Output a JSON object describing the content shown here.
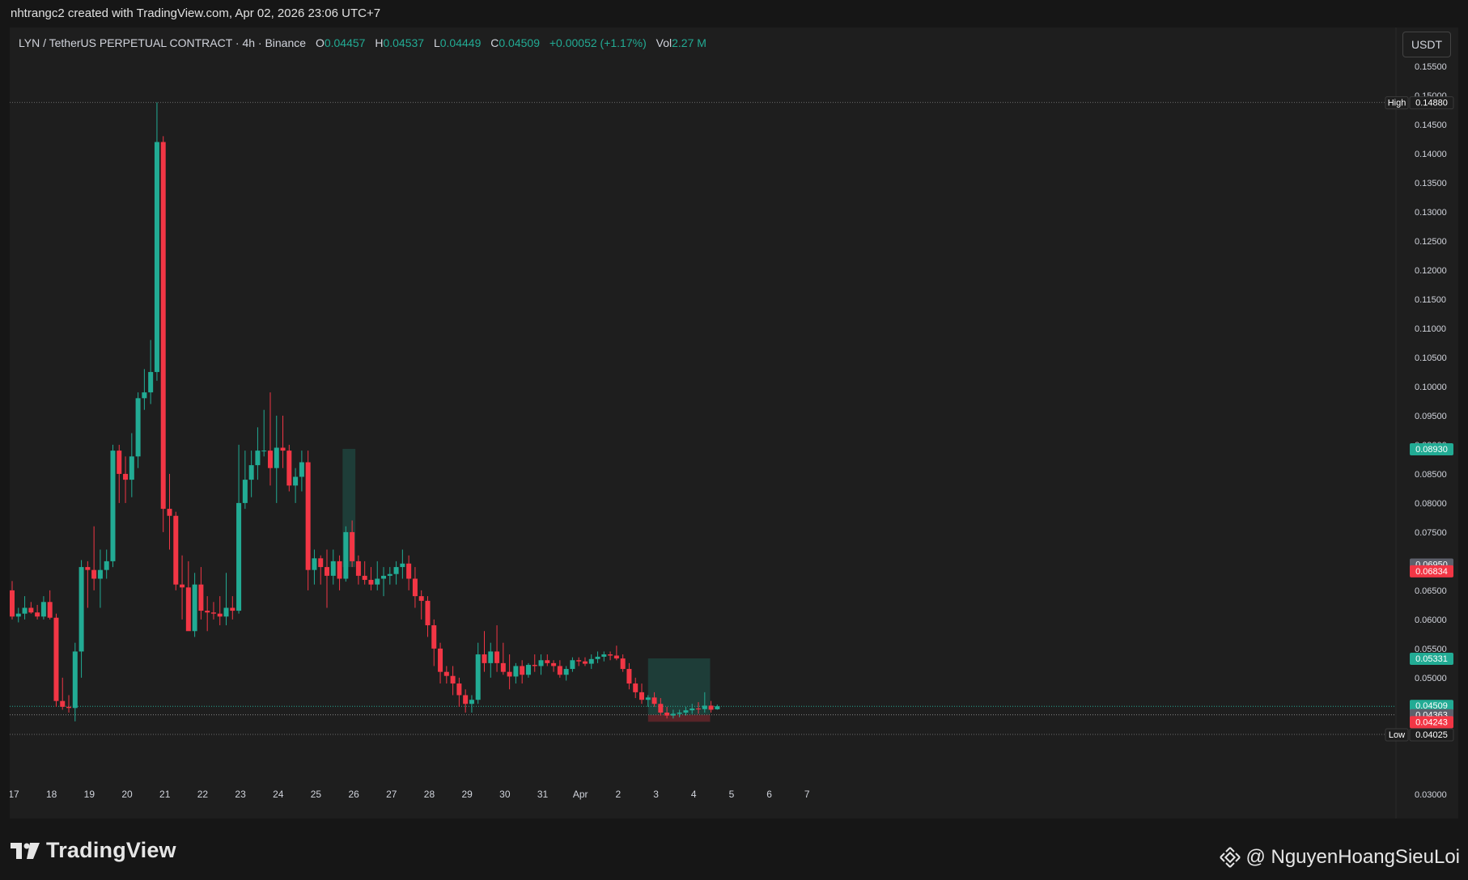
{
  "header": {
    "credit": "nhtrangc2 created with TradingView.com, Apr 02, 2026 23:06 UTC+7"
  },
  "legend": {
    "symbol": "LYN / TetherUS PERPETUAL CONTRACT · 4h · Binance",
    "o_label": "O",
    "o_value": "0.04457",
    "h_label": "H",
    "h_value": "0.04537",
    "l_label": "L",
    "l_value": "0.04449",
    "c_label": "C",
    "c_value": "0.04509",
    "change": "+0.00052 (+1.17%)",
    "vol_label": "Vol",
    "vol_value": "2.27 M"
  },
  "currency_button": "USDT",
  "footer": {
    "brand": "TradingView",
    "watermark": "@ NguyenHoangSieuLoi"
  },
  "colors": {
    "up": "#22ab94",
    "down": "#f23645",
    "background": "#1e1e1e",
    "text": "#d1d4dc"
  },
  "chart_data": {
    "type": "candlestick",
    "timeframe": "4h",
    "y_axis_labels": [
      "0.15500",
      "0.15000",
      "0.14500",
      "0.14000",
      "0.13500",
      "0.13000",
      "0.12500",
      "0.12000",
      "0.11500",
      "0.11000",
      "0.10500",
      "0.10000",
      "0.09500",
      "0.09000",
      "0.08500",
      "0.08000",
      "0.07500",
      "0.07000",
      "0.06500",
      "0.06000",
      "0.05500",
      "0.05000",
      "0.04500",
      "0.03000"
    ],
    "x_axis_labels": [
      "17",
      "18",
      "19",
      "20",
      "21",
      "22",
      "23",
      "24",
      "25",
      "26",
      "27",
      "28",
      "29",
      "30",
      "31",
      "Apr",
      "2",
      "3",
      "4",
      "5",
      "6",
      "7"
    ],
    "ylim": [
      0.0297,
      0.1575
    ],
    "price_tags": [
      {
        "prefix": "High",
        "value": "0.14880",
        "price": 0.1488,
        "style": "extreme"
      },
      {
        "value": "0.08930",
        "price": 0.0893,
        "style": "green"
      },
      {
        "value": "0.06950",
        "price": 0.0695,
        "style": "gray"
      },
      {
        "value": "0.06834",
        "price": 0.06834,
        "style": "red"
      },
      {
        "value": "0.05331",
        "price": 0.05331,
        "style": "green"
      },
      {
        "value": "0.04509",
        "sub": "03:53:38",
        "price": 0.04509,
        "style": "green"
      },
      {
        "value": "0.04363",
        "price": 0.04363,
        "style": "gray"
      },
      {
        "value": "0.04243",
        "price": 0.04243,
        "style": "red"
      },
      {
        "prefix": "Low",
        "value": "0.04025",
        "price": 0.04025,
        "style": "extreme"
      }
    ],
    "candles": [
      [
        0.065,
        0.0666,
        0.06,
        0.0605
      ],
      [
        0.0605,
        0.062,
        0.0595,
        0.061
      ],
      [
        0.061,
        0.064,
        0.06,
        0.062
      ],
      [
        0.062,
        0.063,
        0.061,
        0.0612
      ],
      [
        0.0612,
        0.0625,
        0.06,
        0.0605
      ],
      [
        0.0605,
        0.064,
        0.06,
        0.063
      ],
      [
        0.063,
        0.065,
        0.06,
        0.0603
      ],
      [
        0.0603,
        0.061,
        0.045,
        0.046
      ],
      [
        0.046,
        0.05,
        0.0445,
        0.045
      ],
      [
        0.045,
        0.047,
        0.044,
        0.0448
      ],
      [
        0.0448,
        0.056,
        0.0425,
        0.0545
      ],
      [
        0.0545,
        0.0702,
        0.05,
        0.069
      ],
      [
        0.069,
        0.07,
        0.062,
        0.0685
      ],
      [
        0.0685,
        0.076,
        0.065,
        0.067
      ],
      [
        0.067,
        0.072,
        0.062,
        0.0685
      ],
      [
        0.0685,
        0.072,
        0.067,
        0.07
      ],
      [
        0.07,
        0.09,
        0.069,
        0.089
      ],
      [
        0.089,
        0.09,
        0.08,
        0.085
      ],
      [
        0.085,
        0.088,
        0.08,
        0.084
      ],
      [
        0.084,
        0.092,
        0.081,
        0.088
      ],
      [
        0.088,
        0.099,
        0.086,
        0.098
      ],
      [
        0.098,
        0.103,
        0.096,
        0.099
      ],
      [
        0.099,
        0.108,
        0.097,
        0.1025
      ],
      [
        0.1025,
        0.1488,
        0.101,
        0.142
      ],
      [
        0.142,
        0.143,
        0.075,
        0.079
      ],
      [
        0.079,
        0.085,
        0.072,
        0.0778
      ],
      [
        0.0778,
        0.0785,
        0.065,
        0.066
      ],
      [
        0.066,
        0.071,
        0.06,
        0.0655
      ],
      [
        0.0655,
        0.07,
        0.059,
        0.058
      ],
      [
        0.058,
        0.068,
        0.057,
        0.066
      ],
      [
        0.066,
        0.069,
        0.06,
        0.0615
      ],
      [
        0.0615,
        0.064,
        0.058,
        0.0612
      ],
      [
        0.0612,
        0.063,
        0.06,
        0.061
      ],
      [
        0.061,
        0.064,
        0.059,
        0.0605
      ],
      [
        0.0605,
        0.068,
        0.059,
        0.062
      ],
      [
        0.062,
        0.064,
        0.06,
        0.0615
      ],
      [
        0.0615,
        0.09,
        0.061,
        0.08
      ],
      [
        0.08,
        0.089,
        0.079,
        0.084
      ],
      [
        0.084,
        0.089,
        0.081,
        0.0865
      ],
      [
        0.0865,
        0.093,
        0.084,
        0.089
      ],
      [
        0.089,
        0.096,
        0.088,
        0.089
      ],
      [
        0.089,
        0.099,
        0.083,
        0.086
      ],
      [
        0.086,
        0.095,
        0.08,
        0.0895
      ],
      [
        0.0895,
        0.095,
        0.086,
        0.089
      ],
      [
        0.089,
        0.09,
        0.082,
        0.083
      ],
      [
        0.083,
        0.086,
        0.08,
        0.0845
      ],
      [
        0.0845,
        0.089,
        0.082,
        0.087
      ],
      [
        0.087,
        0.089,
        0.065,
        0.0685
      ],
      [
        0.0685,
        0.072,
        0.066,
        0.0705
      ],
      [
        0.0705,
        0.071,
        0.066,
        0.069
      ],
      [
        0.069,
        0.072,
        0.062,
        0.0675
      ],
      [
        0.0675,
        0.072,
        0.066,
        0.07
      ],
      [
        0.07,
        0.071,
        0.065,
        0.067
      ],
      [
        0.067,
        0.076,
        0.0665,
        0.075
      ],
      [
        0.075,
        0.077,
        0.069,
        0.07
      ],
      [
        0.07,
        0.071,
        0.066,
        0.0675
      ],
      [
        0.0675,
        0.07,
        0.066,
        0.0668
      ],
      [
        0.0668,
        0.069,
        0.065,
        0.066
      ],
      [
        0.066,
        0.07,
        0.065,
        0.067
      ],
      [
        0.067,
        0.069,
        0.064,
        0.0675
      ],
      [
        0.0675,
        0.069,
        0.066,
        0.0678
      ],
      [
        0.0678,
        0.07,
        0.066,
        0.069
      ],
      [
        0.069,
        0.072,
        0.067,
        0.0696
      ],
      [
        0.0696,
        0.071,
        0.065,
        0.067
      ],
      [
        0.067,
        0.069,
        0.062,
        0.064
      ],
      [
        0.064,
        0.065,
        0.06,
        0.0632
      ],
      [
        0.0632,
        0.064,
        0.057,
        0.059
      ],
      [
        0.059,
        0.06,
        0.052,
        0.055
      ],
      [
        0.055,
        0.056,
        0.049,
        0.051
      ],
      [
        0.051,
        0.052,
        0.049,
        0.0503
      ],
      [
        0.0503,
        0.052,
        0.047,
        0.049
      ],
      [
        0.049,
        0.05,
        0.045,
        0.047
      ],
      [
        0.047,
        0.048,
        0.044,
        0.0455
      ],
      [
        0.0455,
        0.047,
        0.044,
        0.0462
      ],
      [
        0.0462,
        0.056,
        0.0455,
        0.054
      ],
      [
        0.054,
        0.058,
        0.051,
        0.0525
      ],
      [
        0.0525,
        0.056,
        0.05,
        0.0545
      ],
      [
        0.0545,
        0.059,
        0.051,
        0.0525
      ],
      [
        0.0525,
        0.056,
        0.0505,
        0.051
      ],
      [
        0.051,
        0.054,
        0.048,
        0.0502
      ],
      [
        0.0502,
        0.0525,
        0.049,
        0.052
      ],
      [
        0.052,
        0.053,
        0.049,
        0.0505
      ],
      [
        0.0505,
        0.0525,
        0.05,
        0.0522
      ],
      [
        0.0522,
        0.054,
        0.051,
        0.052
      ],
      [
        0.052,
        0.054,
        0.0505,
        0.053
      ],
      [
        0.053,
        0.054,
        0.052,
        0.0525
      ],
      [
        0.0525,
        0.053,
        0.051,
        0.052
      ],
      [
        0.052,
        0.053,
        0.05,
        0.0505
      ],
      [
        0.0505,
        0.052,
        0.0495,
        0.0515
      ],
      [
        0.0515,
        0.0535,
        0.051,
        0.053
      ],
      [
        0.053,
        0.0535,
        0.052,
        0.0528
      ],
      [
        0.0528,
        0.0535,
        0.052,
        0.0524
      ],
      [
        0.0524,
        0.054,
        0.0515,
        0.0532
      ],
      [
        0.0532,
        0.0545,
        0.0525,
        0.0536
      ],
      [
        0.0536,
        0.0545,
        0.0528,
        0.054
      ],
      [
        0.054,
        0.0545,
        0.053,
        0.0538
      ],
      [
        0.0538,
        0.0555,
        0.053,
        0.0533
      ],
      [
        0.0533,
        0.054,
        0.051,
        0.0515
      ],
      [
        0.0515,
        0.0525,
        0.048,
        0.049
      ],
      [
        0.049,
        0.05,
        0.0465,
        0.0475
      ],
      [
        0.0475,
        0.049,
        0.0455,
        0.0462
      ],
      [
        0.0462,
        0.047,
        0.045,
        0.0466
      ],
      [
        0.0466,
        0.0475,
        0.045,
        0.0455
      ],
      [
        0.0455,
        0.0465,
        0.0435,
        0.044
      ],
      [
        0.044,
        0.045,
        0.043,
        0.0435
      ],
      [
        0.0435,
        0.0445,
        0.043,
        0.0438
      ],
      [
        0.0438,
        0.0445,
        0.0432,
        0.044
      ],
      [
        0.044,
        0.045,
        0.0435,
        0.0444
      ],
      [
        0.0444,
        0.0455,
        0.0438,
        0.0447
      ],
      [
        0.0447,
        0.0458,
        0.0438,
        0.0446
      ],
      [
        0.0446,
        0.0475,
        0.044,
        0.0452
      ],
      [
        0.0452,
        0.046,
        0.044,
        0.0445
      ],
      [
        0.04457,
        0.04537,
        0.04449,
        0.04509
      ]
    ],
    "highlight_box": {
      "x_from_index": 53,
      "x_to_index": 54,
      "y_top": 0.0893,
      "y_bottom": 0.069
    },
    "position_tool": {
      "x_from_index": 101,
      "x_to_index": 107,
      "profit_top": 0.05331,
      "entry": 0.04363,
      "stop": 0.04243
    }
  }
}
